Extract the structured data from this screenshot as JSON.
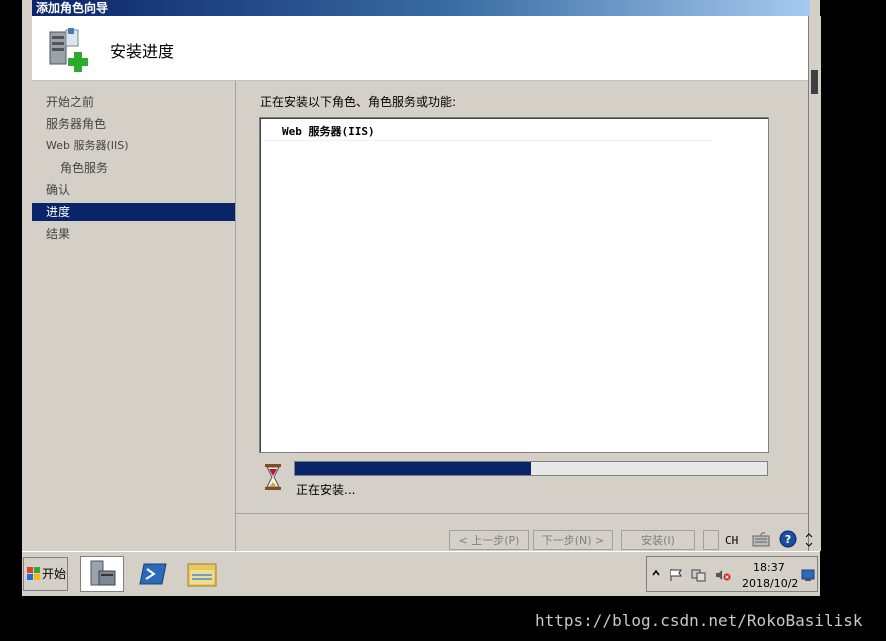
{
  "window": {
    "title": "添加角色向导",
    "header_title": "安装进度"
  },
  "nav": {
    "items": [
      {
        "label": "开始之前"
      },
      {
        "label": "服务器角色"
      },
      {
        "label": "Web 服务器(IIS)"
      },
      {
        "label": "角色服务"
      },
      {
        "label": "确认"
      },
      {
        "label": "进度"
      },
      {
        "label": "结果"
      }
    ]
  },
  "content": {
    "installing_label": "正在安装以下角色、角色服务或功能:",
    "list_items": [
      "Web 服务器(IIS)"
    ],
    "progress_fraction": 0.5,
    "status_text": "正在安装..."
  },
  "buttons": {
    "prev": "< 上一步(P)",
    "next": "下一步(N) >",
    "install": "安装(I)",
    "lang": "CH"
  },
  "taskbar": {
    "start_label": "开始",
    "time": "18:37",
    "date": "2018/10/2"
  },
  "watermark": "https://blog.csdn.net/RokoBasilisk"
}
